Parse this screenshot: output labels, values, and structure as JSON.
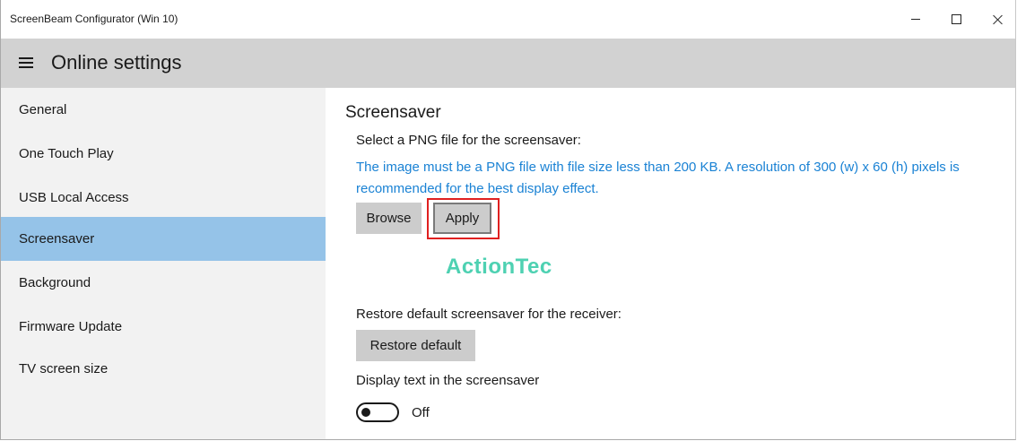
{
  "window": {
    "title": "ScreenBeam Configurator (Win 10)"
  },
  "header": {
    "title": "Online settings",
    "menu_icon": "hamburger-menu-icon"
  },
  "sidebar": {
    "selected": "Screensaver",
    "items": [
      {
        "label": "General"
      },
      {
        "label": "One Touch Play"
      },
      {
        "label": "USB Local Access"
      },
      {
        "label": "Screensaver"
      },
      {
        "label": "Background"
      },
      {
        "label": "Firmware Update"
      },
      {
        "label": "TV screen size"
      }
    ]
  },
  "main": {
    "section_title": "Screensaver",
    "select_label": "Select a PNG file for the screensaver:",
    "info_text": "The image must be a PNG file with file size less than 200 KB. A resolution of 300 (w) x 60 (h) pixels is recommended for the best display effect.",
    "browse_label": "Browse",
    "apply_label": "Apply",
    "preview_logo_text": "ActionTec",
    "restore_label_text": "Restore default screensaver for the receiver:",
    "restore_button_label": "Restore default",
    "display_text_label": "Display text in the screensaver",
    "toggle_state": "Off",
    "toggle_on": false
  },
  "colors": {
    "header_bg": "#d2d2d2",
    "sidebar_bg": "#f2f2f2",
    "selected_bg": "#95c3e8",
    "info_text": "#1a82d4",
    "logo": "#4ed1b2",
    "highlight_border": "#e02020"
  }
}
